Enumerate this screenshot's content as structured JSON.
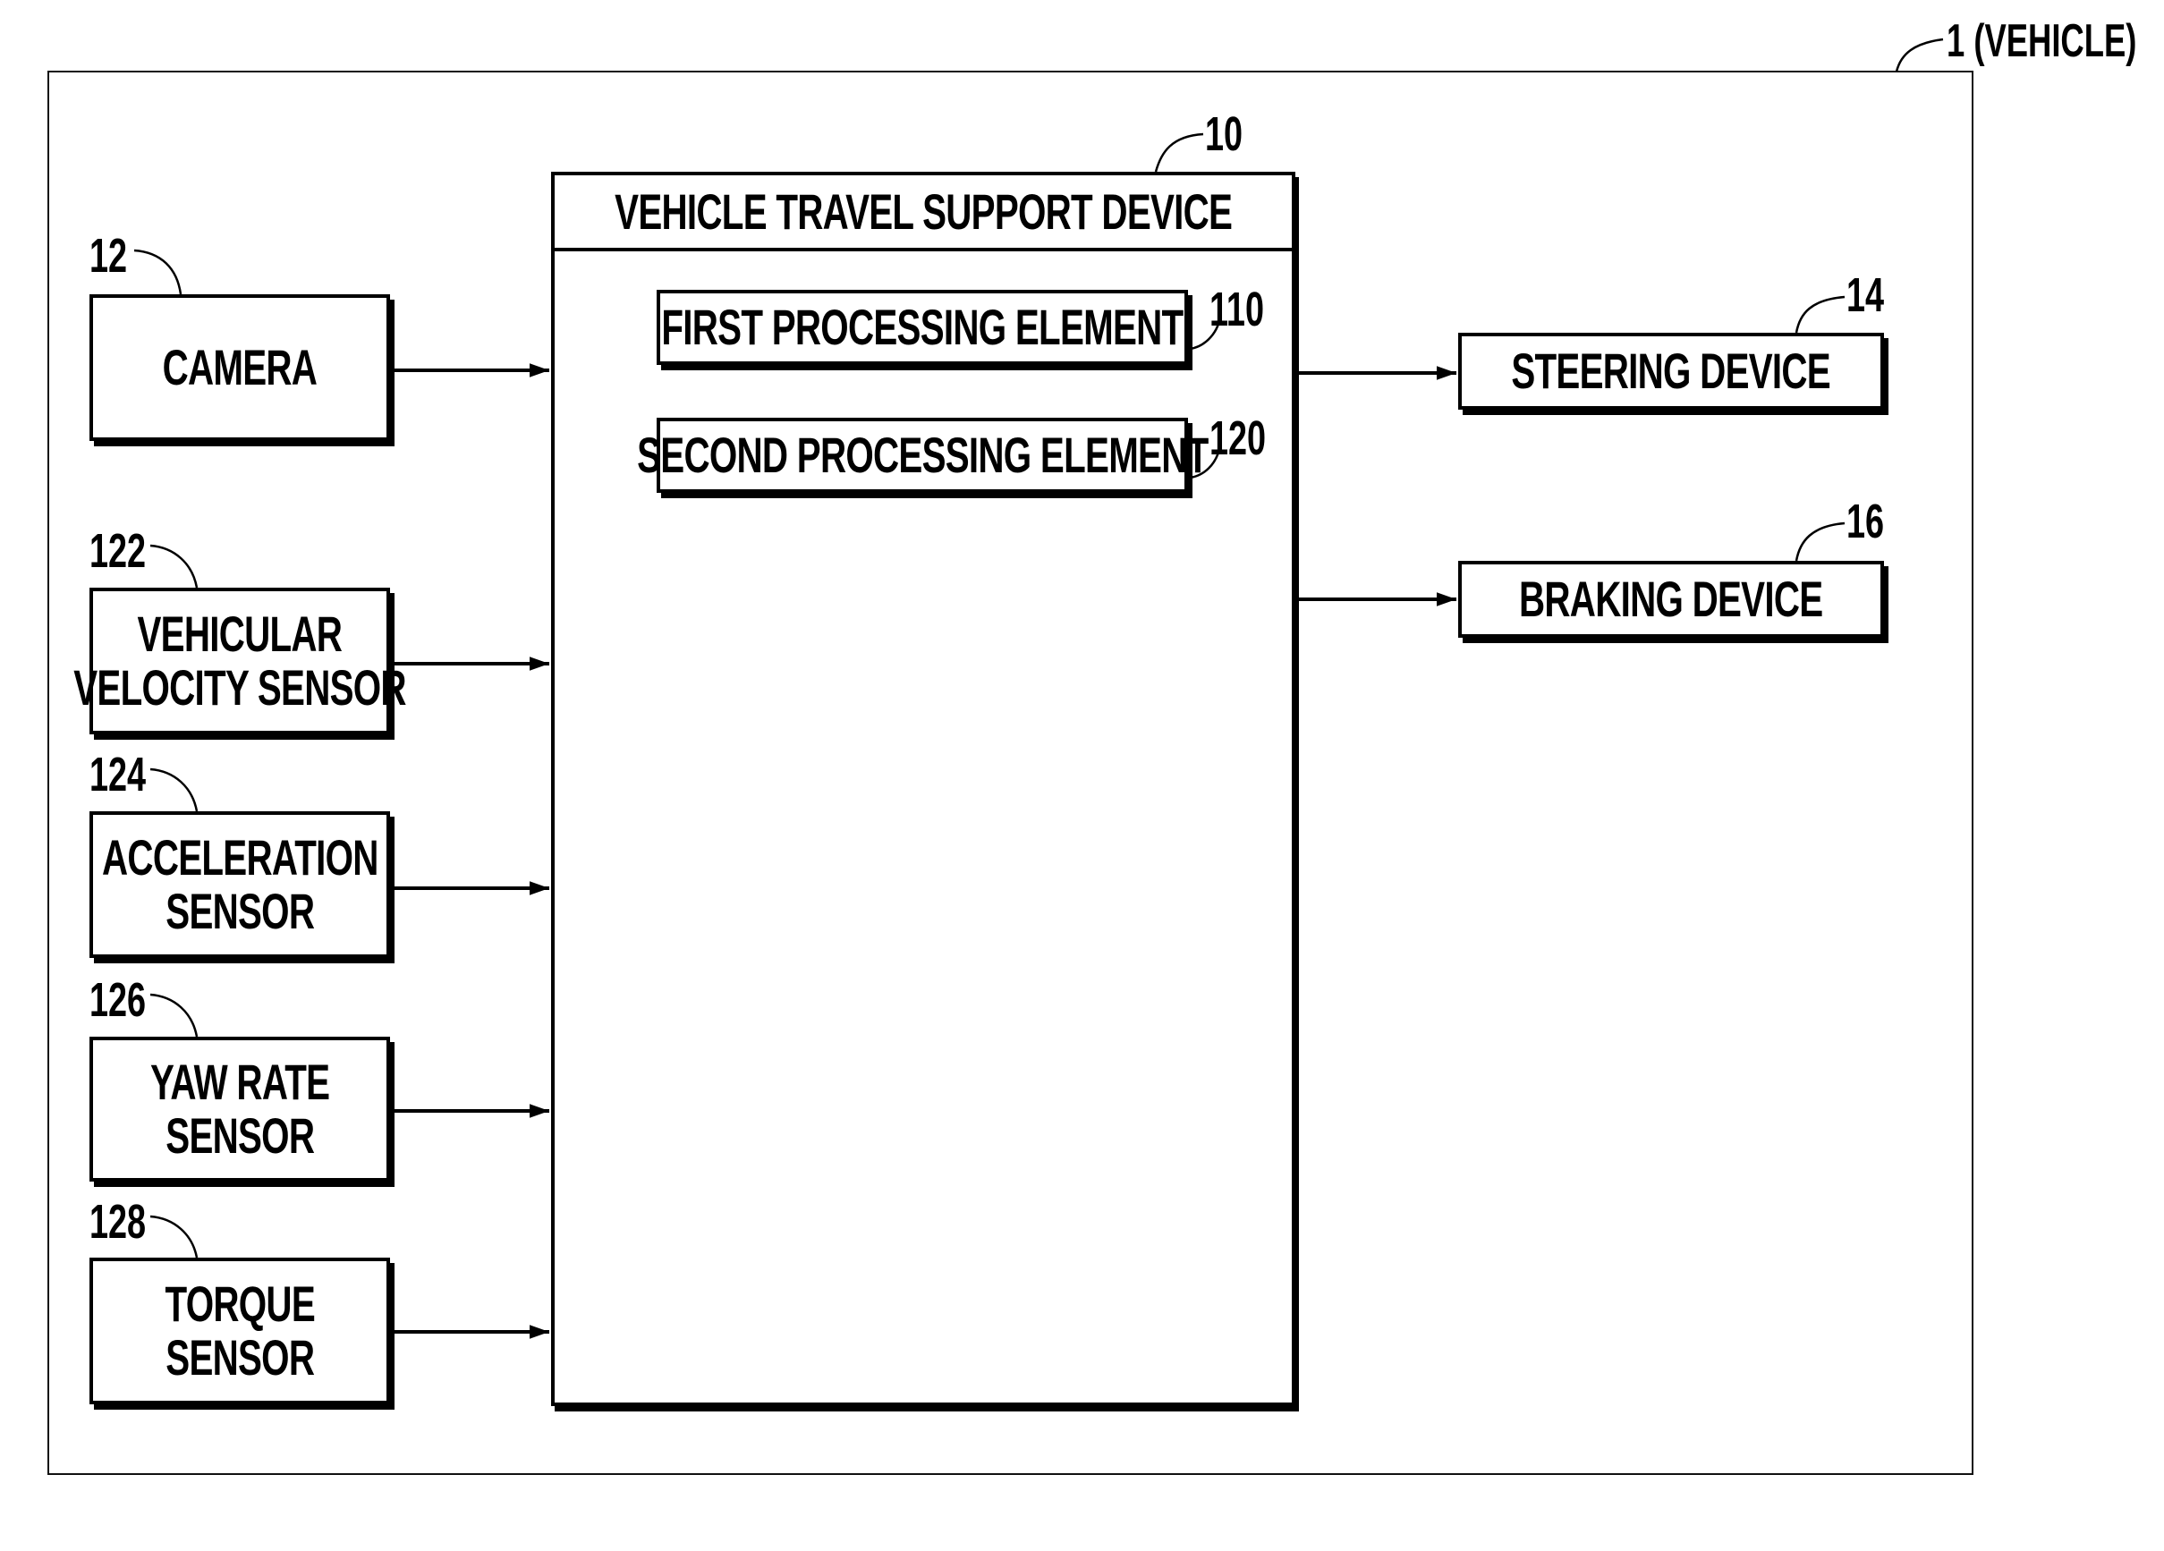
{
  "figure": {
    "vehicle_ref": "1 (VEHICLE)",
    "main_device": {
      "ref": "10",
      "title": "VEHICLE TRAVEL SUPPORT DEVICE",
      "elements": [
        {
          "ref": "110",
          "label": "FIRST PROCESSING ELEMENT"
        },
        {
          "ref": "120",
          "label": "SECOND PROCESSING ELEMENT"
        }
      ]
    },
    "inputs": [
      {
        "ref": "12",
        "lines": [
          "CAMERA"
        ]
      },
      {
        "ref": "122",
        "lines": [
          "VEHICULAR",
          "VELOCITY SENSOR"
        ]
      },
      {
        "ref": "124",
        "lines": [
          "ACCELERATION",
          "SENSOR"
        ]
      },
      {
        "ref": "126",
        "lines": [
          "YAW RATE",
          "SENSOR"
        ]
      },
      {
        "ref": "128",
        "lines": [
          "TORQUE",
          "SENSOR"
        ]
      }
    ],
    "outputs": [
      {
        "ref": "14",
        "label": "STEERING DEVICE"
      },
      {
        "ref": "16",
        "label": "BRAKING DEVICE"
      }
    ]
  }
}
